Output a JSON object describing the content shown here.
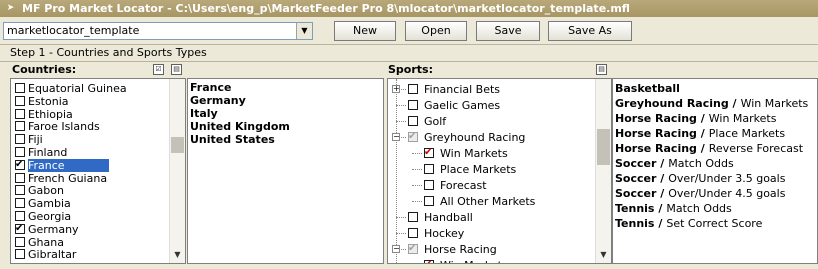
{
  "window": {
    "title": "MF Pro Market Locator - C:\\Users\\eng_p\\MarketFeeder Pro 8\\mlocator\\marketlocator_template.mfl"
  },
  "toolbar": {
    "template_value": "marketlocator_template",
    "new_label": "New",
    "open_label": "Open",
    "save_label": "Save",
    "save_as_label": "Save As"
  },
  "step": {
    "label": "Step 1 - Countries and Sports Types"
  },
  "countries": {
    "header": "Countries:",
    "items": [
      {
        "label": "Equatorial Guinea",
        "checked": false
      },
      {
        "label": "Estonia",
        "checked": false
      },
      {
        "label": "Ethiopia",
        "checked": false
      },
      {
        "label": "Faroe Islands",
        "checked": false
      },
      {
        "label": "Fiji",
        "checked": false
      },
      {
        "label": "Finland",
        "checked": false
      },
      {
        "label": "France",
        "checked": true,
        "selected": true
      },
      {
        "label": "French Guiana",
        "checked": false
      },
      {
        "label": "Gabon",
        "checked": false
      },
      {
        "label": "Gambia",
        "checked": false
      },
      {
        "label": "Georgia",
        "checked": false
      },
      {
        "label": "Germany",
        "checked": true
      },
      {
        "label": "Ghana",
        "checked": false
      },
      {
        "label": "Gibraltar",
        "checked": false
      }
    ],
    "selected": [
      "France",
      "Germany",
      "Italy",
      "United Kingdom",
      "United States"
    ]
  },
  "sports": {
    "header": "Sports:",
    "tree": [
      {
        "label": "Financial Bets",
        "state": "none",
        "level": 0,
        "expander": "+"
      },
      {
        "label": "Gaelic Games",
        "state": "none",
        "level": 0
      },
      {
        "label": "Golf",
        "state": "none",
        "level": 0
      },
      {
        "label": "Greyhound Racing",
        "state": "grey",
        "level": 0,
        "expander": "-"
      },
      {
        "label": "Win Markets",
        "state": "red",
        "level": 1
      },
      {
        "label": "Place Markets",
        "state": "none",
        "level": 1
      },
      {
        "label": "Forecast",
        "state": "none",
        "level": 1
      },
      {
        "label": "All Other Markets",
        "state": "none",
        "level": 1
      },
      {
        "label": "Handball",
        "state": "none",
        "level": 0
      },
      {
        "label": "Hockey",
        "state": "none",
        "level": 0
      },
      {
        "label": "Horse Racing",
        "state": "grey",
        "level": 0,
        "expander": "-"
      },
      {
        "label": "Win Markets",
        "state": "red",
        "level": 1
      }
    ],
    "selected": [
      {
        "sport": "Basketball",
        "market": ""
      },
      {
        "sport": "Greyhound Racing /",
        "market": "Win Markets"
      },
      {
        "sport": "Horse Racing /",
        "market": "Win Markets"
      },
      {
        "sport": "Horse Racing /",
        "market": "Place Markets"
      },
      {
        "sport": "Horse Racing /",
        "market": "Reverse Forecast"
      },
      {
        "sport": "Soccer /",
        "market": "Match Odds"
      },
      {
        "sport": "Soccer /",
        "market": "Over/Under 3.5 goals"
      },
      {
        "sport": "Soccer /",
        "market": "Over/Under 4.5 goals"
      },
      {
        "sport": "Tennis /",
        "market": "Match Odds"
      },
      {
        "sport": "Tennis /",
        "market": "Set Correct Score"
      }
    ]
  }
}
